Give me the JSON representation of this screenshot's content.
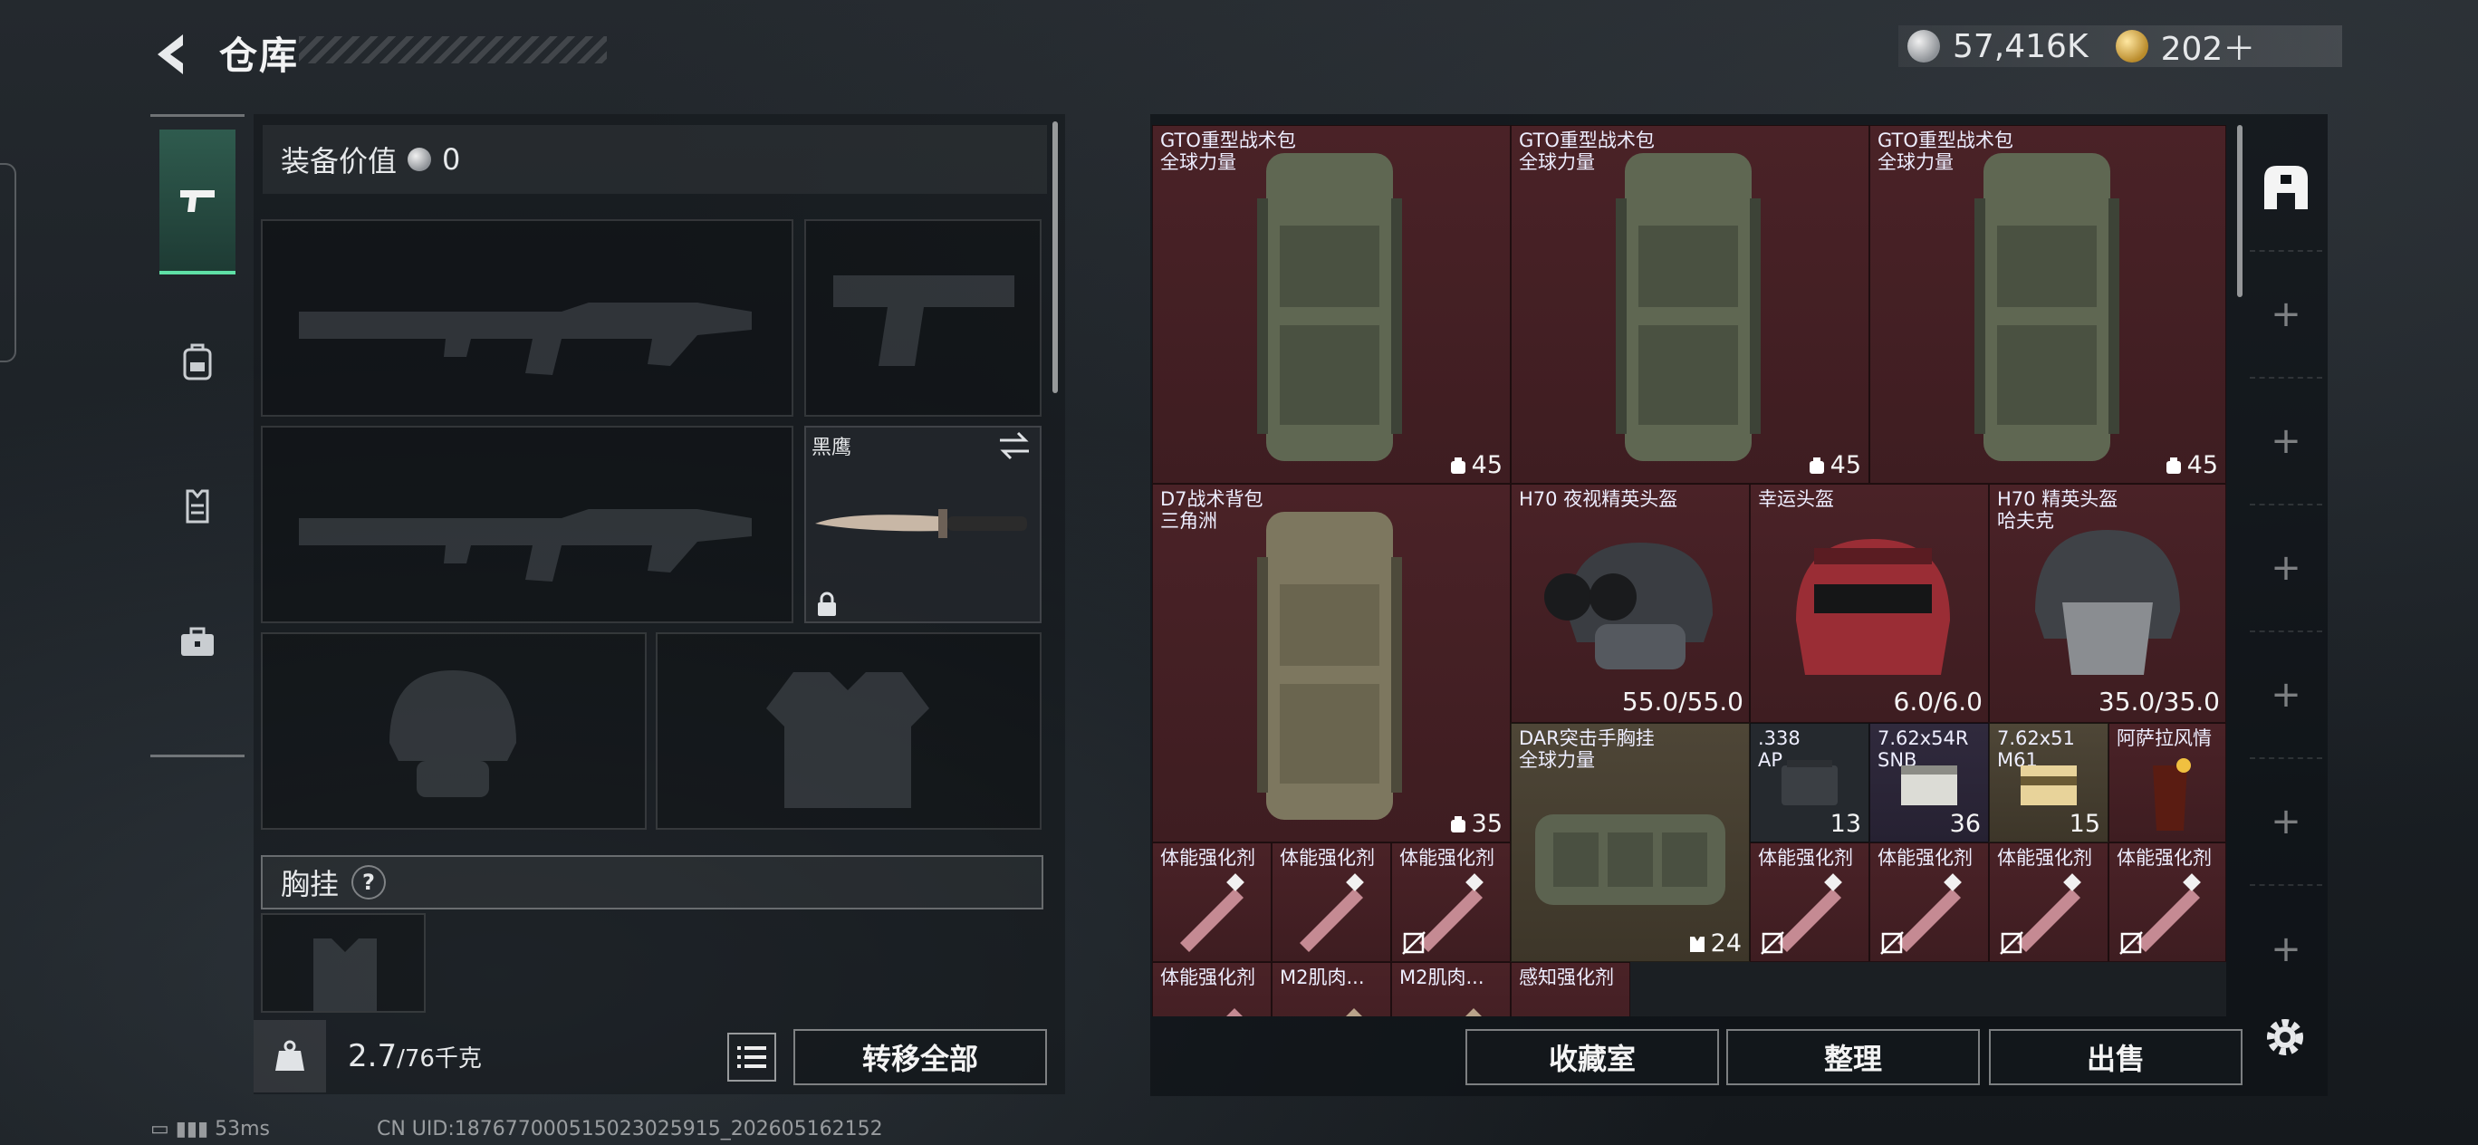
{
  "header": {
    "title": "仓库",
    "currency_silver": "57,416K",
    "currency_gold": "202＋"
  },
  "sidebar": {
    "items": [
      {
        "icon": "pistol-icon",
        "active": true
      },
      {
        "icon": "backpack-icon",
        "active": false
      },
      {
        "icon": "vest-icon",
        "active": false
      },
      {
        "icon": "toolbox-icon",
        "active": false
      }
    ]
  },
  "equipment": {
    "value_label": "装备价值",
    "value": "0",
    "knife_name": "黑鹰",
    "chest_label": "胸挂",
    "chest_help": "?",
    "weight": "2.7",
    "weight_max": "/76千克",
    "transfer_all": "转移全部"
  },
  "stash": {
    "items": [
      {
        "name": "GTO重型战术包",
        "sub": "全球力量",
        "qty": "45"
      },
      {
        "name": "GTO重型战术包",
        "sub": "全球力量",
        "qty": "45"
      },
      {
        "name": "GTO重型战术包",
        "sub": "全球力量",
        "qty": "45"
      },
      {
        "name": "D7战术背包",
        "sub": "三角洲",
        "qty": "35"
      },
      {
        "name": "H70 夜视精英头盔",
        "sub": "",
        "durability": "55.0/55.0"
      },
      {
        "name": "幸运头盔",
        "sub": "",
        "durability": "6.0/6.0"
      },
      {
        "name": "H70 精英头盔",
        "sub": "哈夫克",
        "durability": "35.0/35.0"
      },
      {
        "name": "DAR突击手胸挂",
        "sub": "全球力量",
        "qty": "24"
      },
      {
        "name": ".338",
        "sub": "AP",
        "qty": "13"
      },
      {
        "name": "7.62x54R",
        "sub": "SNB",
        "qty": "36"
      },
      {
        "name": "7.62x51",
        "sub": "M61",
        "qty": "15"
      },
      {
        "name": "阿萨拉风情",
        "sub": "",
        "qty": ""
      },
      {
        "name": "体能强化剂"
      },
      {
        "name": "体能强化剂"
      },
      {
        "name": "体能强化剂"
      },
      {
        "name": "体能强化剂"
      },
      {
        "name": "体能强化剂"
      },
      {
        "name": "体能强化剂"
      },
      {
        "name": "体能强化剂"
      },
      {
        "name": "体能强化剂"
      },
      {
        "name": "M2肌肉..."
      },
      {
        "name": "M2肌肉..."
      },
      {
        "name": "感知强化剂"
      }
    ],
    "buttons": {
      "collection": "收藏室",
      "organize": "整理",
      "sell": "出售"
    }
  },
  "status": {
    "ping": "53ms",
    "uid": "CN UID:18767700051502302​5915_202605162152"
  },
  "colors": {
    "red_rarity": "#4a2227",
    "gold_rarity": "#4e4637",
    "purple_rarity": "#302a3d",
    "accent": "#5fe0a6"
  }
}
